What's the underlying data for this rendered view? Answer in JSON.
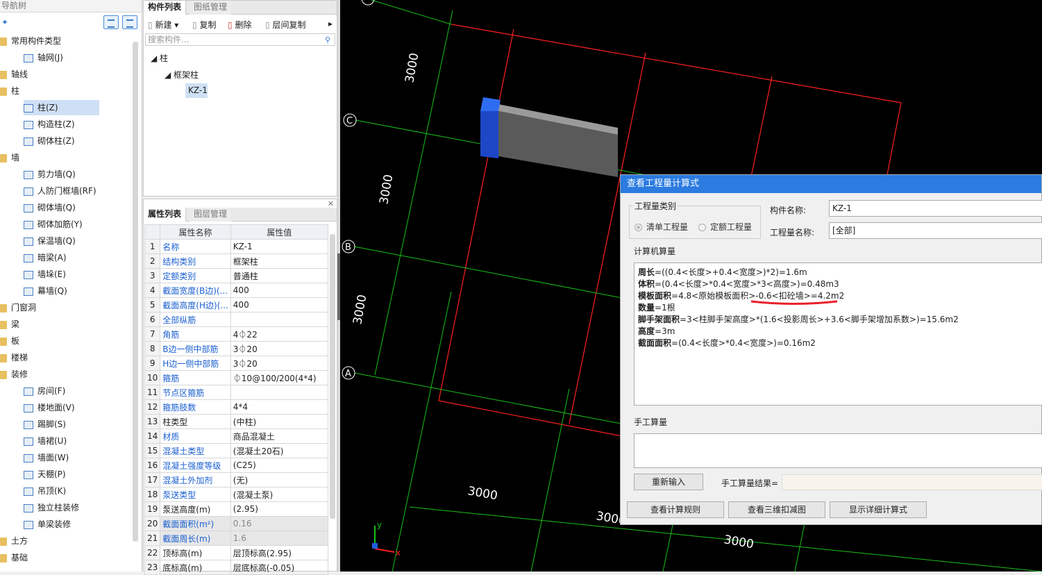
{
  "nav": {
    "title": "导航树",
    "items": [
      {
        "label": "常用构件类型",
        "level": 0
      },
      {
        "label": "轴网(J)",
        "level": 1
      },
      {
        "label": "轴线",
        "level": 0
      },
      {
        "label": "柱",
        "level": 0
      },
      {
        "label": "柱(Z)",
        "level": 1,
        "selected": true
      },
      {
        "label": "构造柱(Z)",
        "level": 1
      },
      {
        "label": "砌体柱(Z)",
        "level": 1
      },
      {
        "label": "墙",
        "level": 0
      },
      {
        "label": "剪力墙(Q)",
        "level": 1
      },
      {
        "label": "人防门框墙(RF)",
        "level": 1
      },
      {
        "label": "砌体墙(Q)",
        "level": 1
      },
      {
        "label": "砌体加筋(Y)",
        "level": 1
      },
      {
        "label": "保温墙(Q)",
        "level": 1
      },
      {
        "label": "暗梁(A)",
        "level": 1
      },
      {
        "label": "墙垛(E)",
        "level": 1
      },
      {
        "label": "幕墙(Q)",
        "level": 1
      },
      {
        "label": "门窗洞",
        "level": 0
      },
      {
        "label": "梁",
        "level": 0
      },
      {
        "label": "板",
        "level": 0
      },
      {
        "label": "楼梯",
        "level": 0
      },
      {
        "label": "装修",
        "level": 0
      },
      {
        "label": "房间(F)",
        "level": 1
      },
      {
        "label": "楼地面(V)",
        "level": 1
      },
      {
        "label": "踢脚(S)",
        "level": 1
      },
      {
        "label": "墙裙(U)",
        "level": 1
      },
      {
        "label": "墙面(W)",
        "level": 1
      },
      {
        "label": "天棚(P)",
        "level": 1
      },
      {
        "label": "吊顶(K)",
        "level": 1
      },
      {
        "label": "独立柱装修",
        "level": 1
      },
      {
        "label": "单梁装修",
        "level": 1
      },
      {
        "label": "土方",
        "level": 0
      },
      {
        "label": "基础",
        "level": 0
      }
    ]
  },
  "components": {
    "tabs": [
      "构件列表",
      "图纸管理"
    ],
    "toolbar": {
      "new": "新建",
      "copy": "复制",
      "delete": "删除",
      "floor_copy": "层间复制"
    },
    "search_placeholder": "搜索构件...",
    "tree": {
      "root": "柱",
      "child": "框架柱",
      "leaf": "KZ-1"
    }
  },
  "properties": {
    "tabs": [
      "属性列表",
      "图层管理"
    ],
    "col_name": "属性名称",
    "col_value": "属性值",
    "rows": [
      {
        "n": "1",
        "k": "名称",
        "v": "KZ-1",
        "blue": true
      },
      {
        "n": "2",
        "k": "结构类别",
        "v": "框架柱",
        "blue": true
      },
      {
        "n": "3",
        "k": "定额类别",
        "v": "普通柱",
        "blue": true
      },
      {
        "n": "4",
        "k": "截面宽度(B边)(...",
        "v": "400",
        "blue": true
      },
      {
        "n": "5",
        "k": "截面高度(H边)(...",
        "v": "400",
        "blue": true
      },
      {
        "n": "6",
        "k": "全部纵筋",
        "v": "",
        "blue": true
      },
      {
        "n": "7",
        "k": "角筋",
        "v": "4⏀22",
        "blue": true
      },
      {
        "n": "8",
        "k": "B边一侧中部筋",
        "v": "3⏀20",
        "blue": true
      },
      {
        "n": "9",
        "k": "H边一侧中部筋",
        "v": "3⏀20",
        "blue": true
      },
      {
        "n": "10",
        "k": "箍筋",
        "v": "⏀10@100/200(4*4)",
        "blue": true
      },
      {
        "n": "11",
        "k": "节点区箍筋",
        "v": "",
        "blue": true
      },
      {
        "n": "12",
        "k": "箍筋肢数",
        "v": "4*4",
        "blue": true
      },
      {
        "n": "13",
        "k": "柱类型",
        "v": "(中柱)",
        "blue": false
      },
      {
        "n": "14",
        "k": "材质",
        "v": "商品混凝土",
        "blue": true
      },
      {
        "n": "15",
        "k": "混凝土类型",
        "v": "(混凝土20石)",
        "blue": true
      },
      {
        "n": "16",
        "k": "混凝土强度等级",
        "v": "(C25)",
        "blue": true
      },
      {
        "n": "17",
        "k": "混凝土外加剂",
        "v": "(无)",
        "blue": true
      },
      {
        "n": "18",
        "k": "泵送类型",
        "v": "(混凝土泵)",
        "blue": true
      },
      {
        "n": "19",
        "k": "泵送高度(m)",
        "v": "(2.95)",
        "blue": false
      },
      {
        "n": "20",
        "k": "截面面积(m²)",
        "v": "0.16",
        "blue": true,
        "gray": true
      },
      {
        "n": "21",
        "k": "截面周长(m)",
        "v": "1.6",
        "blue": true,
        "gray": true
      },
      {
        "n": "22",
        "k": "顶标高(m)",
        "v": "层顶标高(2.95)",
        "blue": false
      },
      {
        "n": "23",
        "k": "底标高(m)",
        "v": "层底标高(-0.05)",
        "blue": false
      }
    ]
  },
  "canvas": {
    "axes": [
      "A",
      "B",
      "C"
    ],
    "dims": [
      "3000",
      "3000",
      "3000",
      "3000",
      "3000",
      "3000"
    ],
    "axis_y": "y",
    "axis_x": "x"
  },
  "dialog": {
    "title": "查看工程量计算式",
    "qty_type_label": "工程量类别",
    "radio_list": "清单工程量",
    "radio_quota": "定额工程量",
    "comp_name_label": "构件名称:",
    "comp_name": "KZ-1",
    "qty_name_label": "工程量名称:",
    "qty_name": "[全部]",
    "computer_label": "计算机算量",
    "lines": [
      {
        "b": "周长",
        "t": "=((0.4<长度>+0.4<宽度>)*2)=1.6m"
      },
      {
        "b": "体积",
        "t": "=(0.4<长度>*0.4<宽度>*3<高度>)=0.48m3"
      },
      {
        "b": "模板面积",
        "t": "=4.8<原始模板面积>-0.6<扣砼墙>=4.2m2"
      },
      {
        "b": "数量",
        "t": "=1根"
      },
      {
        "b": "脚手架面积",
        "t": "=3<柱脚手架高度>*(1.6<投影周长>+3.6<脚手架增加系数>)=15.6m2"
      },
      {
        "b": "高度",
        "t": "=3m"
      },
      {
        "b": "截面面积",
        "t": "=(0.4<长度>*0.4<宽度>)=0.16m2"
      }
    ],
    "manual_label": "手工算量",
    "reenter": "重新输入",
    "manual_result_label": "手工算量结果=",
    "btn_rules": "查看计算规则",
    "btn_3d": "查看三维扣减图",
    "btn_detail": "显示详细计算式"
  },
  "colors": {
    "accent": "#2b7be0",
    "grid_red": "#ff2020",
    "grid_green": "#19c019",
    "column_blue": "#1f5ee0"
  }
}
